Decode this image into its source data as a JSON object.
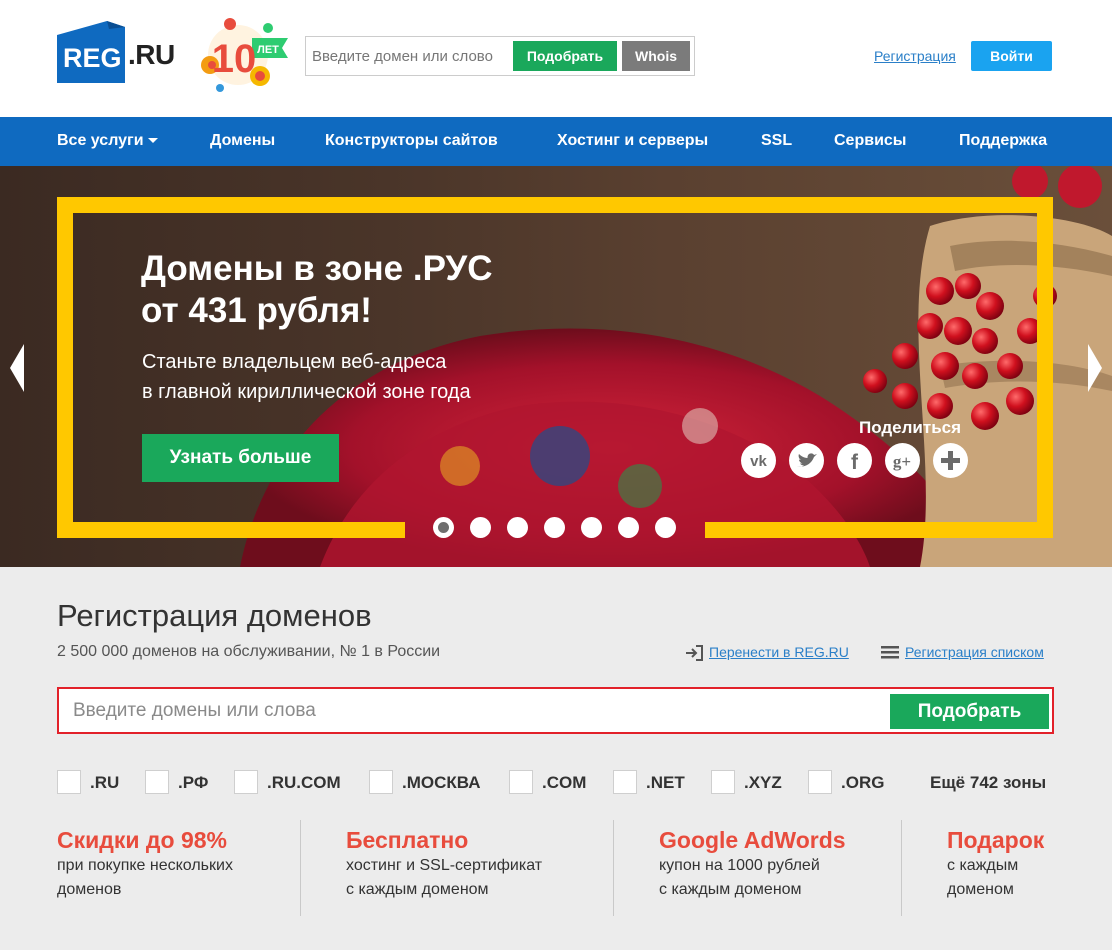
{
  "header": {
    "logo_text": "REG",
    "logo_ru": ".RU",
    "anniversary_text": "ЛЕТ",
    "anniversary_number": "10",
    "search_placeholder": "Введите домен или слово",
    "pick_label": "Подобрать",
    "whois_label": "Whois",
    "register_link": "Регистрация",
    "login_label": "Войти"
  },
  "nav": {
    "items": [
      "Все услуги",
      "Домены",
      "Конструкторы сайтов",
      "Хостинг и серверы",
      "SSL",
      "Сервисы",
      "Поддержка"
    ]
  },
  "banner": {
    "title_line1": "Домены в зоне .РУС",
    "title_line2": "от 431 рубля!",
    "subtitle_line1": "Станьте владельцем веб-адреса",
    "subtitle_line2": "в главной кириллической зоне года",
    "button_label": "Узнать больше",
    "share_label": "Поделиться",
    "social_icons": [
      "vk-icon",
      "twitter-icon",
      "facebook-icon",
      "google-plus-icon",
      "plus-icon"
    ],
    "slide_count": 7,
    "active_slide": 1,
    "accent_color": "#ffc800"
  },
  "domains": {
    "title": "Регистрация доменов",
    "subtitle": "2 500 000 доменов на обслуживании, № 1 в России",
    "transfer_link": "Перенести в REG.RU",
    "list_link": "Регистрация списком",
    "search_placeholder": "Введите домены или слова",
    "pick_label": "Подобрать",
    "zones": [
      ".RU",
      ".РФ",
      ".RU.COM",
      ".МОСКВА",
      ".COM",
      ".NET",
      ".XYZ",
      ".ORG"
    ],
    "more_zones": "Ещё 742 зоны"
  },
  "promos": [
    {
      "title": "Скидки до 98%",
      "line1": "при покупке нескольких",
      "line2": "доменов"
    },
    {
      "title": "Бесплатно",
      "line1": "хостинг и SSL-сертификат",
      "line2": "с каждым доменом"
    },
    {
      "title": "Google AdWords",
      "line1": "купон на 1000 рублей",
      "line2": "с каждым доменом"
    },
    {
      "title": "Подарок",
      "line1": "с каждым",
      "line2": "доменом"
    }
  ],
  "colors": {
    "brand_blue": "#0f6ac0",
    "green": "#1aa85b",
    "promo_red": "#e84c3d",
    "search_border": "#e2212a"
  }
}
